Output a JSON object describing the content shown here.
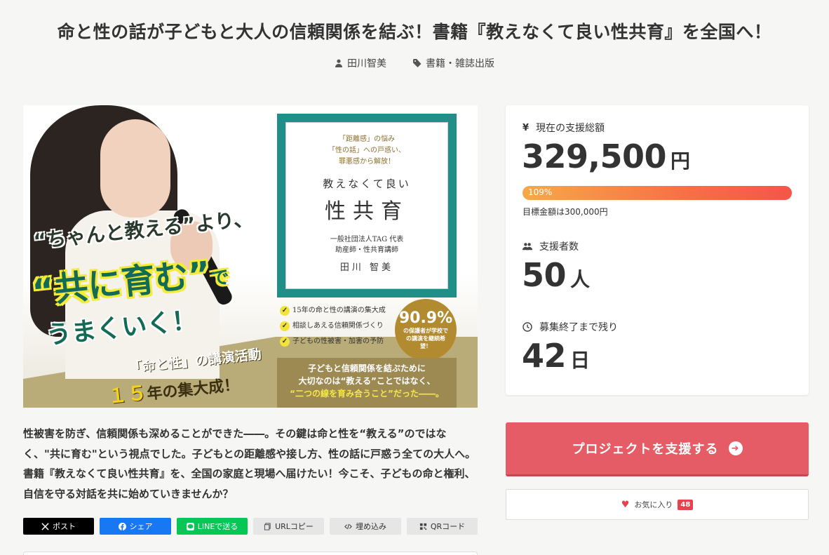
{
  "header": {
    "title": "命と性の話が子どもと大人の信頼関係を結ぶ！書籍『教えなくて良い性共育』を全国へ！",
    "author": "田川智美",
    "category": "書籍・雑誌出版"
  },
  "hero": {
    "copy1": "“ちゃんと教える”より、",
    "copy2_main": "“共に育む”",
    "copy2_suffix": "で",
    "copy3": "うまくいく！",
    "copy4": "「命と性」の講演活動",
    "copy5_num": "１５",
    "copy5_rest": "年の集大成！",
    "book_sub1": "「距離感」の悩み",
    "book_sub2": "「性の話」への戸惑い、",
    "book_sub3": "罪悪感から解放！",
    "book_title1": "教えなくて良い",
    "book_title2": "性共育",
    "book_author_role1": "一般社団法人TAG 代表",
    "book_author_role2": "助産師・性共育講師",
    "book_author_name": "田川 智美",
    "check1": "15年の命と性の講演の集大成",
    "check2": "相談しあえる信頼関係づくり",
    "check3": "子どもの性被害・加害の予防",
    "badge_pct": "90.9%",
    "badge_text": "の保護者が学校での講演を継続希望！",
    "bottom1": "子どもと信頼関係を結ぶために",
    "bottom2": "大切なのは“教える”ことではなく、",
    "bottom3": "“二つの線を育み合うこと”だった――。"
  },
  "description": "性被害を防ぎ、信頼関係も深めることができた――。その鍵は命と性を“教える”のではなく、\"共に育む\"という視点でした。子どもとの距離感や接し方、性の話に戸惑う全ての大人へ。書籍『教えなくて良い性共育』を、全国の家庭と現場へ届けたい！今こそ、子どもの命と権利、自信を守る対話を共に始めていきませんか？",
  "share": {
    "x": "ポスト",
    "facebook": "シェア",
    "line": "LINEで送る",
    "url": "URLコピー",
    "embed": "埋め込み",
    "qr": "QRコード"
  },
  "stats": {
    "total_label": "現在の支援総額",
    "total_value": "329,500",
    "total_unit": "円",
    "progress_text": "109%",
    "progress_pct": 109,
    "goal_text": "目標金額は300,000円",
    "backers_label": "支援者数",
    "backers_value": "50",
    "backers_unit": "人",
    "remaining_label": "募集終了まで残り",
    "remaining_value": "42",
    "remaining_unit": "日"
  },
  "actions": {
    "support_label": "プロジェクトを支援する",
    "favorite_label": "お気に入り",
    "favorite_count": "48"
  },
  "colors": {
    "support_button": "#e65c66",
    "favorite_badge": "#e6434f",
    "book_cover": "#1f8f88"
  }
}
